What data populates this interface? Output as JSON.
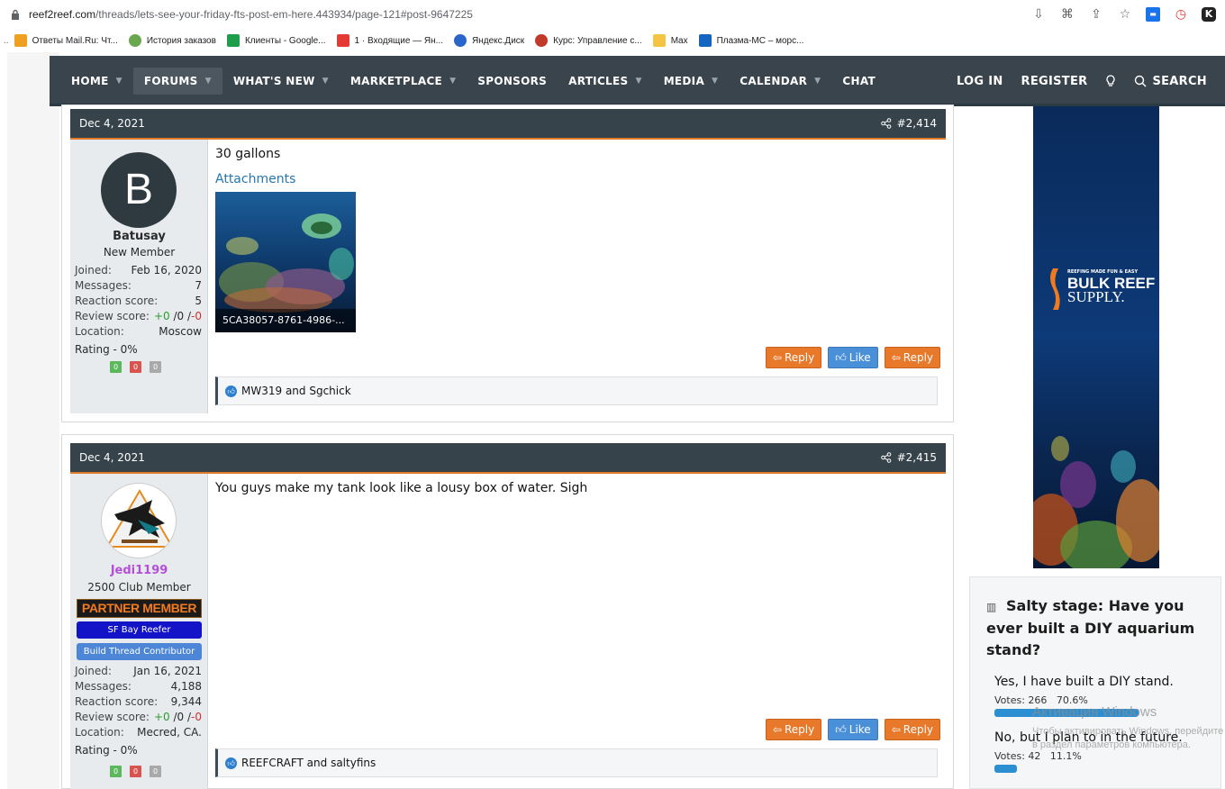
{
  "browser": {
    "url_domain": "reef2reef.com",
    "url_path": "/threads/lets-see-your-friday-fts-post-em-here.443934/page-121#post-9647225",
    "bookmarks_lead": "..",
    "bookmarks": [
      {
        "label": "Ответы Mail.Ru: Чт...",
        "icon": "mailru-answers-icon",
        "color": "#f0a020"
      },
      {
        "label": "История заказов",
        "icon": "orders-history-icon",
        "color": "#6aa84f"
      },
      {
        "label": "Клиенты - Google...",
        "icon": "google-sheets-icon",
        "color": "#1e9e4a"
      },
      {
        "label": "1 · Входящие — Ян...",
        "icon": "yandex-mail-icon",
        "color": "#e53935"
      },
      {
        "label": "Яндекс.Диск",
        "icon": "yandex-disk-icon",
        "color": "#2a66c9"
      },
      {
        "label": "Курс: Управление с...",
        "icon": "course-icon",
        "color": "#c0392b"
      },
      {
        "label": "Max",
        "icon": "folder-icon",
        "color": "#f4c542"
      },
      {
        "label": "Плазма-МС – морс...",
        "icon": "plasma-ms-icon",
        "color": "#1565c0"
      }
    ]
  },
  "nav": {
    "items": [
      {
        "label": "HOME",
        "caret": true
      },
      {
        "label": "FORUMS",
        "caret": true,
        "active": true
      },
      {
        "label": "WHAT'S NEW",
        "caret": true
      },
      {
        "label": "MARKETPLACE",
        "caret": true
      },
      {
        "label": "SPONSORS",
        "caret": false
      },
      {
        "label": "ARTICLES",
        "caret": true
      },
      {
        "label": "MEDIA",
        "caret": true
      },
      {
        "label": "CALENDAR",
        "caret": true
      },
      {
        "label": "CHAT",
        "caret": false
      }
    ],
    "login": "LOG IN",
    "register": "REGISTER",
    "search": "SEARCH"
  },
  "posts": [
    {
      "date": "Dec 4, 2021",
      "number": "#2,414",
      "avatar_letter": "B",
      "username": "Batusay",
      "user_title": "New Member",
      "username_color": "#2a2a2a",
      "joined_label": "Joined:",
      "joined": "Feb 16, 2020",
      "messages_label": "Messages:",
      "messages": "7",
      "reaction_label": "Reaction score:",
      "reaction": "5",
      "review_label": "Review score:",
      "review_pos": "+0",
      "review_mid": " /0 /",
      "review_neg": "-0",
      "location_label": "Location:",
      "location": "Moscow",
      "rating": "Rating - 0%",
      "rate_buttons": [
        "0",
        "0",
        "0"
      ],
      "body": "30 gallons",
      "attachments_label": "Attachments",
      "attachment_name": "5CA38057-8761-4986-...",
      "reply_label": "Reply",
      "like_label": "Like",
      "reply2_label": "Reply",
      "reactions": "MW319 and Sgchick"
    },
    {
      "date": "Dec 4, 2021",
      "number": "#2,415",
      "username": "Jedi1199",
      "user_title": "2500 Club Member",
      "username_color": "#b44fd8",
      "banner_partner": "PARTNER MEMBER",
      "banner_sfbay": "SF Bay Reefer",
      "banner_build": "Build Thread Contributor",
      "joined_label": "Joined:",
      "joined": "Jan 16, 2021",
      "messages_label": "Messages:",
      "messages": "4,188",
      "reaction_label": "Reaction score:",
      "reaction": "9,344",
      "review_label": "Review score:",
      "review_pos": "+0",
      "review_mid": " /0 /",
      "review_neg": "-0",
      "location_label": "Location:",
      "location": "Mecred, CA.",
      "rating": "Rating - 0%",
      "rate_buttons": [
        "0",
        "0",
        "0"
      ],
      "body": "You guys make my tank look like a lousy box of water. Sigh",
      "reply_label": "Reply",
      "like_label": "Like",
      "reply2_label": "Reply",
      "reactions": "REEFCRAFT and saltyfins"
    }
  ],
  "ad": {
    "tagline": "REEFING MADE FUN & EASY",
    "brand_line1": "BULK REEF",
    "brand_line2": "SUPPLY."
  },
  "poll": {
    "title": "Salty stage: Have you ever built a DIY aquarium stand?",
    "options": [
      {
        "label": "Yes, I have built a DIY stand.",
        "votes_text": "Votes: 266",
        "percent_text": "70.6%",
        "percent": 70.6
      },
      {
        "label": "No, but I plan to in the future.",
        "votes_text": "Votes: 42",
        "percent_text": "11.1%",
        "percent": 11.1
      }
    ]
  },
  "watermark": {
    "line1": "Активация Windows",
    "line2": "Чтобы активировать Windows, перейдите в раздел параметров компьютера."
  },
  "colors": {
    "nav_bg": "#3a444c",
    "post_header": "#36434b",
    "accent_orange": "#e8782a",
    "like_blue": "#4a90d9",
    "link_blue": "#2577b1"
  }
}
